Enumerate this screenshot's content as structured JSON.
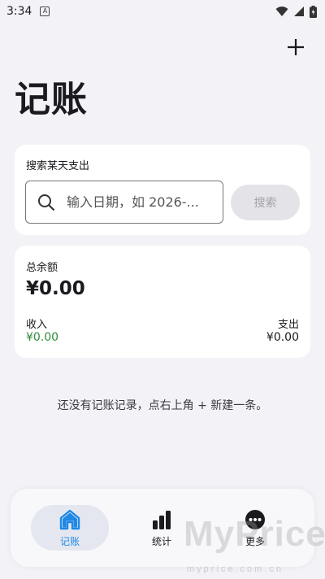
{
  "status_bar": {
    "time": "3:34",
    "app_indicator": "A",
    "icons": [
      "wifi-icon",
      "signal-icon",
      "battery-icon"
    ]
  },
  "header": {
    "title": "记账",
    "add_icon": "plus-icon"
  },
  "search_card": {
    "title": "搜索某天支出",
    "placeholder": "输入日期，如 2026-...",
    "button_label": "搜索"
  },
  "balance_card": {
    "total_label": "总余额",
    "total_value": "¥0.00",
    "income_label": "收入",
    "income_value": "¥0.00",
    "expense_label": "支出",
    "expense_value": "¥0.00"
  },
  "empty_state": "还没有记账记录，点右上角 + 新建一条。",
  "bottom_nav": {
    "items": [
      {
        "label": "记账",
        "icon": "home-icon",
        "active": true
      },
      {
        "label": "统计",
        "icon": "bar-chart-icon",
        "active": false
      },
      {
        "label": "更多",
        "icon": "more-icon",
        "active": false
      }
    ]
  },
  "watermark": {
    "main": "MyPrice",
    "sub": "myprice.com.cn"
  },
  "colors": {
    "background": "#f3f2f7",
    "accent": "#1e88e5",
    "income": "#2e8b3a"
  }
}
